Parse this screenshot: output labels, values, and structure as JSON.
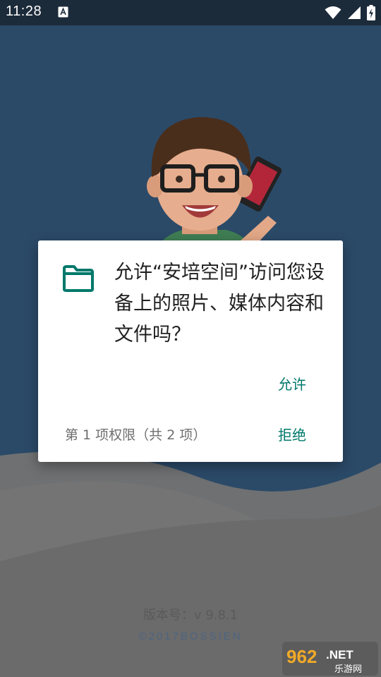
{
  "status_bar": {
    "time": "11:28",
    "notification_icon": "app-notification-icon",
    "icons": [
      "wifi-icon",
      "cell-signal-icon",
      "battery-charging-icon"
    ]
  },
  "splash": {
    "version": "版本号：v 9.8.1",
    "copyright": "©2017BOSSIEN",
    "watermark": {
      "number": "962",
      "suffix": ".NET",
      "site": "乐游网"
    }
  },
  "dialog": {
    "icon": "folder-icon",
    "message": "允许“安培空间”访问您设备上的照片、媒体内容和文件吗？",
    "allow_label": "允许",
    "deny_label": "拒绝",
    "counter": "第 1 项权限（共 2 项）"
  },
  "colors": {
    "accent": "#00796b",
    "status_bar_bg": "#1c2b3a",
    "splash_blue": "#2b4a68"
  }
}
